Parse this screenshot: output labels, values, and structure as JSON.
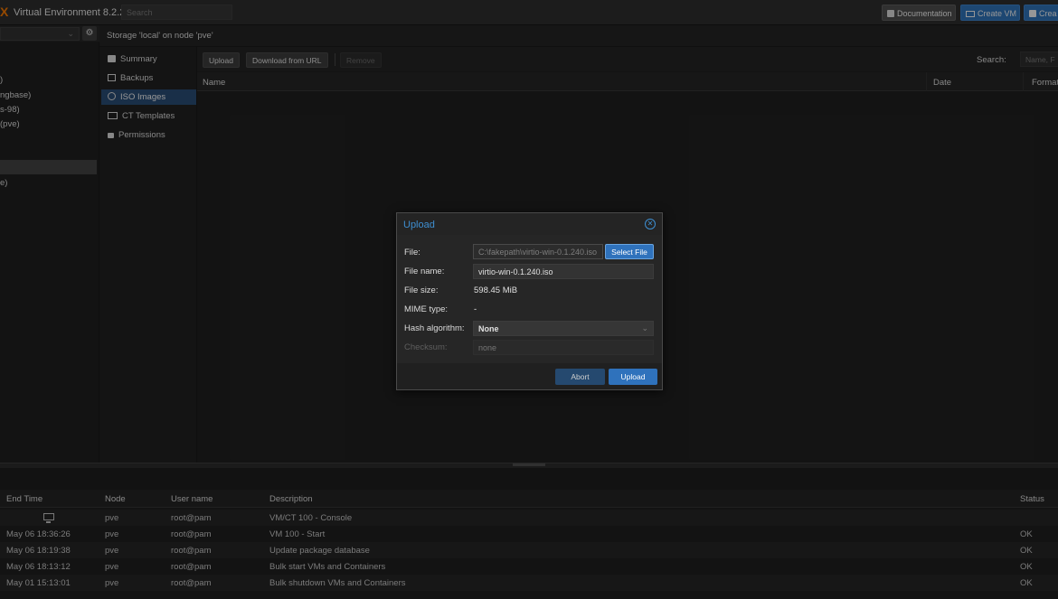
{
  "topbar": {
    "product_mark": "X",
    "title": "Virtual Environment 8.2.2",
    "search_placeholder": "Search",
    "documentation_label": "Documentation",
    "create_vm_label": "Create VM",
    "create_ct_label": "Crea"
  },
  "tree": {
    "items": [
      ")",
      "ngbase)",
      "s-98)",
      "(pve)",
      "e)"
    ]
  },
  "content": {
    "title": "Storage 'local' on node 'pve'"
  },
  "storage_nav": {
    "items": [
      {
        "label": "Summary",
        "icon": "summary-icon"
      },
      {
        "label": "Backups",
        "icon": "backups-icon"
      },
      {
        "label": "ISO Images",
        "icon": "iso-icon"
      },
      {
        "label": "CT Templates",
        "icon": "ct-templates-icon"
      },
      {
        "label": "Permissions",
        "icon": "permissions-icon"
      }
    ],
    "active_index": 2
  },
  "toolbar": {
    "upload_label": "Upload",
    "download_label": "Download from URL",
    "remove_label": "Remove",
    "search_label": "Search:",
    "search_placeholder": "Name, F"
  },
  "grid": {
    "columns": [
      "Name",
      "Date",
      "Format"
    ]
  },
  "dialog": {
    "title": "Upload",
    "file_label": "File:",
    "file_value": "C:\\fakepath\\virtio-win-0.1.240.iso",
    "select_file_label": "Select File",
    "filename_label": "File name:",
    "filename_value": "virtio-win-0.1.240.iso",
    "filesize_label": "File size:",
    "filesize_value": "598.45 MiB",
    "mime_label": "MIME type:",
    "mime_value": "-",
    "hash_label": "Hash algorithm:",
    "hash_value": "None",
    "checksum_label": "Checksum:",
    "checksum_placeholder": "none",
    "abort_label": "Abort",
    "upload_label": "Upload",
    "accent_color": "#3e8ed0"
  },
  "tasklog": {
    "columns": [
      "End Time",
      "Node",
      "User name",
      "Description",
      "Status"
    ],
    "rows": [
      {
        "end_time": "",
        "node": "pve",
        "user": "root@pam",
        "description": "VM/CT 100 - Console",
        "status": ""
      },
      {
        "end_time": "May 06 18:36:26",
        "node": "pve",
        "user": "root@pam",
        "description": "VM 100 - Start",
        "status": "OK"
      },
      {
        "end_time": "May 06 18:19:38",
        "node": "pve",
        "user": "root@pam",
        "description": "Update package database",
        "status": "OK"
      },
      {
        "end_time": "May 06 18:13:12",
        "node": "pve",
        "user": "root@pam",
        "description": "Bulk start VMs and Containers",
        "status": "OK"
      },
      {
        "end_time": "May 01 15:13:01",
        "node": "pve",
        "user": "root@pam",
        "description": "Bulk shutdown VMs and Containers",
        "status": "OK"
      }
    ]
  }
}
